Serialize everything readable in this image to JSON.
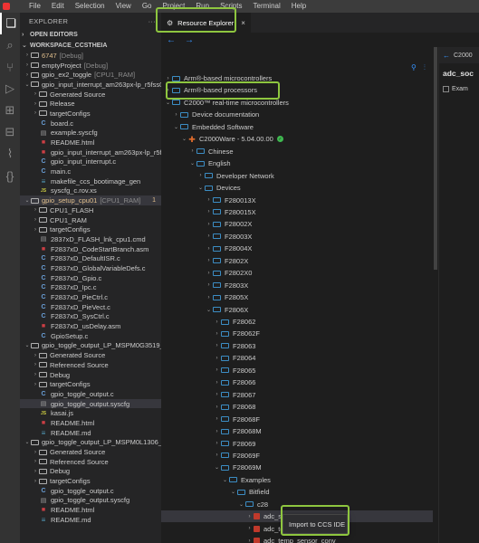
{
  "menu": [
    "File",
    "Edit",
    "Selection",
    "View",
    "Go",
    "Project",
    "Run",
    "Scripts",
    "Terminal",
    "Help"
  ],
  "sidebar": {
    "title": "EXPLORER",
    "more": "···",
    "open_editors": "OPEN EDITORS",
    "workspace": "WORKSPACE_CCSTHEIA",
    "rows": [
      {
        "indent": 0,
        "chev": ">",
        "icon": "folder",
        "label": "6747",
        "suffix": "[Debug]",
        "labelClass": "yellow",
        "badge": ""
      },
      {
        "indent": 0,
        "chev": ">",
        "icon": "folder",
        "label": "emptyProject",
        "suffix": "[Debug]",
        "labelClass": "",
        "badge": ""
      },
      {
        "indent": 0,
        "chev": ">",
        "icon": "folder",
        "label": "gpio_ex2_toggle",
        "suffix": "[CPU1_RAM]",
        "labelClass": "",
        "badge": ""
      },
      {
        "indent": 0,
        "chev": "v",
        "icon": "folder",
        "label": "gpio_input_interrupt_am263px-lp_r5fss0-0_nort",
        "suffix": "",
        "labelClass": "",
        "badge": ""
      },
      {
        "indent": 1,
        "chev": ">",
        "icon": "folder",
        "label": "Generated Source",
        "suffix": "",
        "labelClass": "",
        "badge": ""
      },
      {
        "indent": 1,
        "chev": ">",
        "icon": "folder",
        "label": "Release",
        "suffix": "",
        "labelClass": "",
        "badge": ""
      },
      {
        "indent": 1,
        "chev": ">",
        "icon": "folder",
        "label": "targetConfigs",
        "suffix": "",
        "labelClass": "",
        "badge": ""
      },
      {
        "indent": 1,
        "chev": "",
        "icon": "file-c",
        "label": "board.c",
        "suffix": "",
        "labelClass": "",
        "badge": ""
      },
      {
        "indent": 1,
        "chev": "",
        "icon": "file-gen",
        "label": "example.syscfg",
        "suffix": "",
        "labelClass": "",
        "badge": ""
      },
      {
        "indent": 1,
        "chev": "",
        "icon": "file-red",
        "label": "README.html",
        "suffix": "",
        "labelClass": "",
        "badge": ""
      },
      {
        "indent": 1,
        "chev": "",
        "icon": "file-red",
        "label": "gpio_input_interrupt_am263px-lp_r5fss0-...",
        "suffix": "",
        "labelClass": "",
        "badge": ""
      },
      {
        "indent": 1,
        "chev": "",
        "icon": "file-c",
        "label": "gpio_input_interrupt.c",
        "suffix": "",
        "labelClass": "",
        "badge": ""
      },
      {
        "indent": 1,
        "chev": "",
        "icon": "file-c",
        "label": "main.c",
        "suffix": "",
        "labelClass": "",
        "badge": ""
      },
      {
        "indent": 1,
        "chev": "",
        "icon": "file-md",
        "label": "makefile_ccs_bootimage_gen",
        "suffix": "",
        "labelClass": "",
        "badge": ""
      },
      {
        "indent": 1,
        "chev": "",
        "icon": "file-js",
        "label": "syscfg_c.rov.xs",
        "suffix": "",
        "labelClass": "",
        "badge": ""
      },
      {
        "indent": 0,
        "chev": "v",
        "icon": "folder",
        "label": "gpio_setup_cpu01",
        "suffix": "[CPU1_RAM]",
        "labelClass": "yellow",
        "badge": "1",
        "selected": true
      },
      {
        "indent": 1,
        "chev": ">",
        "icon": "folder",
        "label": "CPU1_FLASH",
        "suffix": "",
        "labelClass": "",
        "badge": ""
      },
      {
        "indent": 1,
        "chev": ">",
        "icon": "folder",
        "label": "CPU1_RAM",
        "suffix": "",
        "labelClass": "",
        "badge": ""
      },
      {
        "indent": 1,
        "chev": ">",
        "icon": "folder",
        "label": "targetConfigs",
        "suffix": "",
        "labelClass": "",
        "badge": ""
      },
      {
        "indent": 1,
        "chev": "",
        "icon": "file-gen",
        "label": "2837xD_FLASH_lnk_cpu1.cmd",
        "suffix": "",
        "labelClass": "",
        "badge": ""
      },
      {
        "indent": 1,
        "chev": "",
        "icon": "file-red",
        "label": "F2837xD_CodeStartBranch.asm",
        "suffix": "",
        "labelClass": "",
        "badge": ""
      },
      {
        "indent": 1,
        "chev": "",
        "icon": "file-c",
        "label": "F2837xD_DefaultISR.c",
        "suffix": "",
        "labelClass": "",
        "badge": ""
      },
      {
        "indent": 1,
        "chev": "",
        "icon": "file-c",
        "label": "F2837xD_GlobalVariableDefs.c",
        "suffix": "",
        "labelClass": "",
        "badge": ""
      },
      {
        "indent": 1,
        "chev": "",
        "icon": "file-c",
        "label": "F2837xD_Gpio.c",
        "suffix": "",
        "labelClass": "",
        "badge": ""
      },
      {
        "indent": 1,
        "chev": "",
        "icon": "file-c",
        "label": "F2837xD_Ipc.c",
        "suffix": "",
        "labelClass": "",
        "badge": ""
      },
      {
        "indent": 1,
        "chev": "",
        "icon": "file-c",
        "label": "F2837xD_PieCtrl.c",
        "suffix": "",
        "labelClass": "",
        "badge": ""
      },
      {
        "indent": 1,
        "chev": "",
        "icon": "file-c",
        "label": "F2837xD_PieVect.c",
        "suffix": "",
        "labelClass": "",
        "badge": ""
      },
      {
        "indent": 1,
        "chev": "",
        "icon": "file-c",
        "label": "F2837xD_SysCtrl.c",
        "suffix": "",
        "labelClass": "",
        "badge": ""
      },
      {
        "indent": 1,
        "chev": "",
        "icon": "file-red",
        "label": "F2837xD_usDelay.asm",
        "suffix": "",
        "labelClass": "",
        "badge": ""
      },
      {
        "indent": 1,
        "chev": "",
        "icon": "file-c",
        "label": "GpioSetup.c",
        "suffix": "",
        "labelClass": "",
        "badge": ""
      },
      {
        "indent": 0,
        "chev": "v",
        "icon": "folder",
        "label": "gpio_toggle_output_LP_MSPM0G3519_nortos_ti...",
        "suffix": "",
        "labelClass": "",
        "badge": ""
      },
      {
        "indent": 1,
        "chev": ">",
        "icon": "folder",
        "label": "Generated Source",
        "suffix": "",
        "labelClass": "",
        "badge": ""
      },
      {
        "indent": 1,
        "chev": ">",
        "icon": "folder",
        "label": "Referenced Source",
        "suffix": "",
        "labelClass": "",
        "badge": ""
      },
      {
        "indent": 1,
        "chev": ">",
        "icon": "folder",
        "label": "Debug",
        "suffix": "",
        "labelClass": "",
        "badge": ""
      },
      {
        "indent": 1,
        "chev": ">",
        "icon": "folder",
        "label": "targetConfigs",
        "suffix": "",
        "labelClass": "",
        "badge": ""
      },
      {
        "indent": 1,
        "chev": "",
        "icon": "file-c",
        "label": "gpio_toggle_output.c",
        "suffix": "",
        "labelClass": "",
        "badge": ""
      },
      {
        "indent": 1,
        "chev": "",
        "icon": "file-gen",
        "label": "gpio_toggle_output.syscfg",
        "suffix": "",
        "labelClass": "",
        "badge": "",
        "hl": true
      },
      {
        "indent": 1,
        "chev": "",
        "icon": "file-js",
        "label": "kasai.js",
        "suffix": "",
        "labelClass": "",
        "badge": ""
      },
      {
        "indent": 1,
        "chev": "",
        "icon": "file-red",
        "label": "README.html",
        "suffix": "",
        "labelClass": "",
        "badge": ""
      },
      {
        "indent": 1,
        "chev": "",
        "icon": "file-md",
        "label": "README.md",
        "suffix": "",
        "labelClass": "",
        "badge": ""
      },
      {
        "indent": 0,
        "chev": "v",
        "icon": "folder",
        "label": "gpio_toggle_output_LP_MSPM0L1306_nortos_ti...",
        "suffix": "",
        "labelClass": "",
        "badge": ""
      },
      {
        "indent": 1,
        "chev": ">",
        "icon": "folder",
        "label": "Generated Source",
        "suffix": "",
        "labelClass": "",
        "badge": ""
      },
      {
        "indent": 1,
        "chev": ">",
        "icon": "folder",
        "label": "Referenced Source",
        "suffix": "",
        "labelClass": "",
        "badge": ""
      },
      {
        "indent": 1,
        "chev": ">",
        "icon": "folder",
        "label": "Debug",
        "suffix": "",
        "labelClass": "",
        "badge": ""
      },
      {
        "indent": 1,
        "chev": ">",
        "icon": "folder",
        "label": "targetConfigs",
        "suffix": "",
        "labelClass": "",
        "badge": ""
      },
      {
        "indent": 1,
        "chev": "",
        "icon": "file-c",
        "label": "gpio_toggle_output.c",
        "suffix": "",
        "labelClass": "",
        "badge": ""
      },
      {
        "indent": 1,
        "chev": "",
        "icon": "file-gen",
        "label": "gpio_toggle_output.syscfg",
        "suffix": "",
        "labelClass": "",
        "badge": ""
      },
      {
        "indent": 1,
        "chev": "",
        "icon": "file-red",
        "label": "README.html",
        "suffix": "",
        "labelClass": "",
        "badge": ""
      },
      {
        "indent": 1,
        "chev": "",
        "icon": "file-md",
        "label": "README.md",
        "suffix": "",
        "labelClass": "",
        "badge": ""
      }
    ]
  },
  "editor": {
    "tab_label": "Resource Explorer",
    "tab_close": "×",
    "nav_back": "←",
    "nav_forward": "→"
  },
  "resource_tree": [
    {
      "indent": 0,
      "chev": ">",
      "icon": "folder",
      "label": "Arm®-based microcontrollers",
      "badge": ""
    },
    {
      "indent": 0,
      "chev": ">",
      "icon": "folder",
      "label": "Arm®-based processors",
      "badge": ""
    },
    {
      "indent": 0,
      "chev": "v",
      "icon": "folder",
      "label": "C2000™ real-time microcontrollers",
      "badge": ""
    },
    {
      "indent": 1,
      "chev": ">",
      "icon": "folder",
      "label": "Device documentation",
      "badge": ""
    },
    {
      "indent": 1,
      "chev": "v",
      "icon": "folder",
      "label": "Embedded Software",
      "badge": ""
    },
    {
      "indent": 2,
      "chev": "v",
      "icon": "c2000",
      "label": "C2000Ware - 5.04.00.00",
      "badge": "ok"
    },
    {
      "indent": 3,
      "chev": ">",
      "icon": "folder",
      "label": "Chinese",
      "badge": ""
    },
    {
      "indent": 3,
      "chev": "v",
      "icon": "folder",
      "label": "English",
      "badge": ""
    },
    {
      "indent": 4,
      "chev": ">",
      "icon": "folder",
      "label": "Developer Network",
      "badge": ""
    },
    {
      "indent": 4,
      "chev": "v",
      "icon": "folder",
      "label": "Devices",
      "badge": ""
    },
    {
      "indent": 5,
      "chev": ">",
      "icon": "folder",
      "label": "F280013X",
      "badge": ""
    },
    {
      "indent": 5,
      "chev": ">",
      "icon": "folder",
      "label": "F280015X",
      "badge": ""
    },
    {
      "indent": 5,
      "chev": ">",
      "icon": "folder",
      "label": "F28002X",
      "badge": ""
    },
    {
      "indent": 5,
      "chev": ">",
      "icon": "folder",
      "label": "F28003X",
      "badge": ""
    },
    {
      "indent": 5,
      "chev": ">",
      "icon": "folder",
      "label": "F28004X",
      "badge": ""
    },
    {
      "indent": 5,
      "chev": ">",
      "icon": "folder",
      "label": "F2802X",
      "badge": ""
    },
    {
      "indent": 5,
      "chev": ">",
      "icon": "folder",
      "label": "F2802X0",
      "badge": ""
    },
    {
      "indent": 5,
      "chev": ">",
      "icon": "folder",
      "label": "F2803X",
      "badge": ""
    },
    {
      "indent": 5,
      "chev": ">",
      "icon": "folder",
      "label": "F2805X",
      "badge": ""
    },
    {
      "indent": 5,
      "chev": "v",
      "icon": "folder",
      "label": "F2806X",
      "badge": ""
    },
    {
      "indent": 6,
      "chev": ">",
      "icon": "folder",
      "label": "F28062",
      "badge": ""
    },
    {
      "indent": 6,
      "chev": ">",
      "icon": "folder",
      "label": "F28062F",
      "badge": ""
    },
    {
      "indent": 6,
      "chev": ">",
      "icon": "folder",
      "label": "F28063",
      "badge": ""
    },
    {
      "indent": 6,
      "chev": ">",
      "icon": "folder",
      "label": "F28064",
      "badge": ""
    },
    {
      "indent": 6,
      "chev": ">",
      "icon": "folder",
      "label": "F28065",
      "badge": ""
    },
    {
      "indent": 6,
      "chev": ">",
      "icon": "folder",
      "label": "F28066",
      "badge": ""
    },
    {
      "indent": 6,
      "chev": ">",
      "icon": "folder",
      "label": "F28067",
      "badge": ""
    },
    {
      "indent": 6,
      "chev": ">",
      "icon": "folder",
      "label": "F28068",
      "badge": ""
    },
    {
      "indent": 6,
      "chev": ">",
      "icon": "folder",
      "label": "F28068F",
      "badge": ""
    },
    {
      "indent": 6,
      "chev": ">",
      "icon": "folder",
      "label": "F28068M",
      "badge": ""
    },
    {
      "indent": 6,
      "chev": ">",
      "icon": "folder",
      "label": "F28069",
      "badge": ""
    },
    {
      "indent": 6,
      "chev": ">",
      "icon": "folder",
      "label": "F28069F",
      "badge": ""
    },
    {
      "indent": 6,
      "chev": "v",
      "icon": "folder",
      "label": "F28069M",
      "badge": ""
    },
    {
      "indent": 7,
      "chev": "v",
      "icon": "folder",
      "label": "Examples",
      "badge": ""
    },
    {
      "indent": 8,
      "chev": "v",
      "icon": "folder",
      "label": "Bitfield",
      "badge": ""
    },
    {
      "indent": 9,
      "chev": "v",
      "icon": "folder",
      "label": "c28",
      "badge": ""
    },
    {
      "indent": 10,
      "chev": ">",
      "icon": "red",
      "label": "adc_soc",
      "badge": "",
      "selected": true
    },
    {
      "indent": 10,
      "chev": ">",
      "icon": "red",
      "label": "adc_temp_sensor",
      "badge": ""
    },
    {
      "indent": 10,
      "chev": ">",
      "icon": "red",
      "label": "adc_temp_sensor_conv",
      "badge": ""
    }
  ],
  "details": {
    "crumb": "C2000",
    "back": "←",
    "title": "adc_soc",
    "sub": "Exam"
  },
  "context_menu": {
    "label": "Import to CCS IDE"
  },
  "annotation_color": "#8ec63f"
}
